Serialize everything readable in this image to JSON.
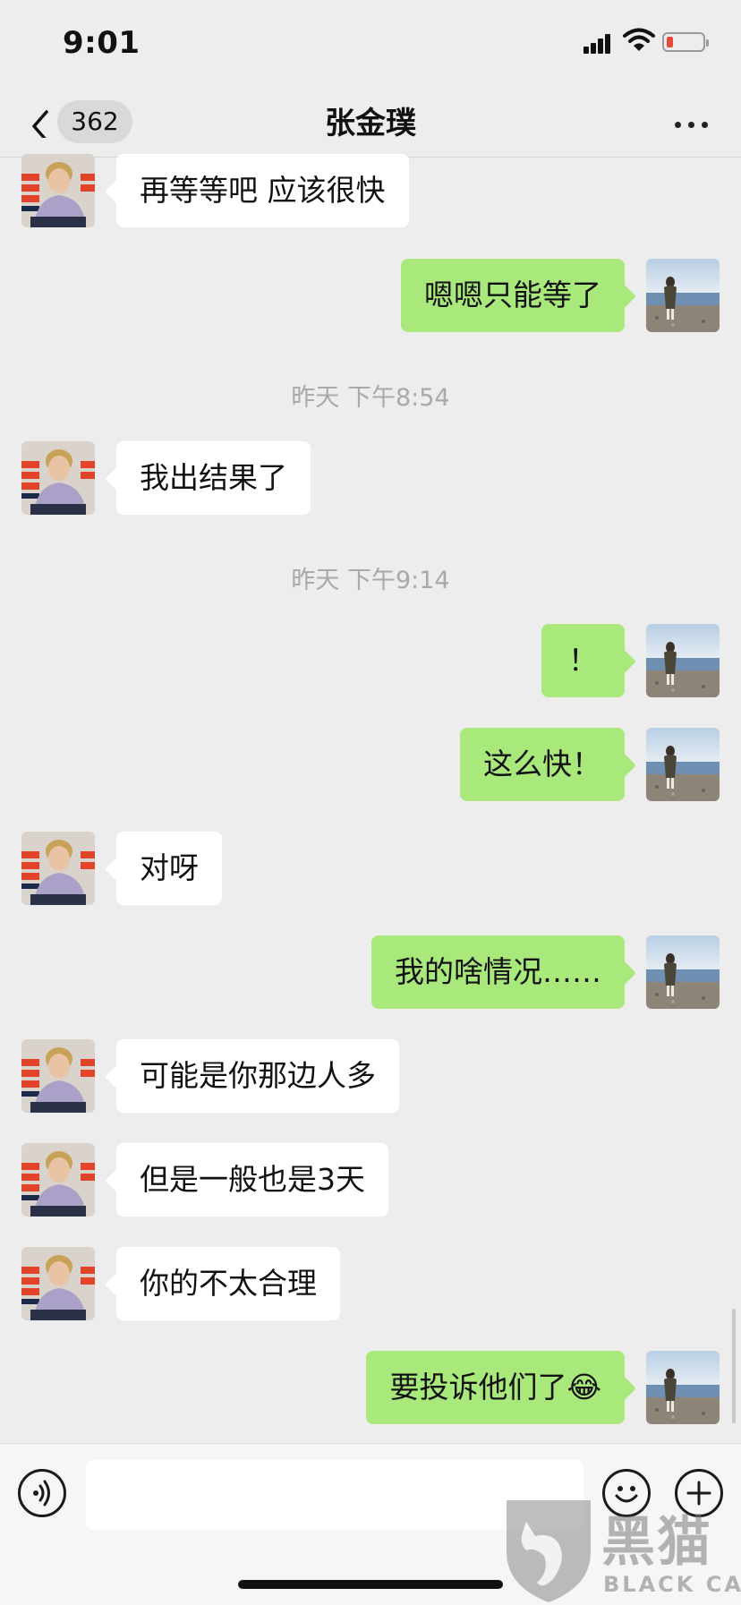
{
  "status_bar": {
    "time": "9:01"
  },
  "nav": {
    "unread_count": "362",
    "title": "张金璞"
  },
  "messages": [
    {
      "text": "再等等吧 应该很快",
      "from": "contact"
    },
    {
      "text": "嗯嗯只能等了",
      "from": "me"
    },
    {
      "text": "我出结果了",
      "from": "contact"
    },
    {
      "text": "！",
      "from": "me"
    },
    {
      "text": "这么快！",
      "from": "me"
    },
    {
      "text": "对呀",
      "from": "contact"
    },
    {
      "text": "我的啥情况……",
      "from": "me"
    },
    {
      "text": "可能是你那边人多",
      "from": "contact"
    },
    {
      "text": "但是一般也是3天",
      "from": "contact"
    },
    {
      "text": "你的不太合理",
      "from": "contact"
    },
    {
      "text": "要投诉他们了😂",
      "from": "me"
    }
  ],
  "timestamps": [
    "昨天 下午8:54",
    "昨天 下午9:14"
  ],
  "input": {
    "value": ""
  },
  "watermark": {
    "cn": "黑猫",
    "en": "BLACK CAT"
  },
  "colors": {
    "outgoing_bubble": "#a9e97c",
    "incoming_bubble": "#ffffff",
    "background": "#ededed"
  },
  "icons": [
    "back-chevron-icon",
    "more-icon",
    "voice-icon",
    "emoji-icon",
    "plus-icon"
  ]
}
